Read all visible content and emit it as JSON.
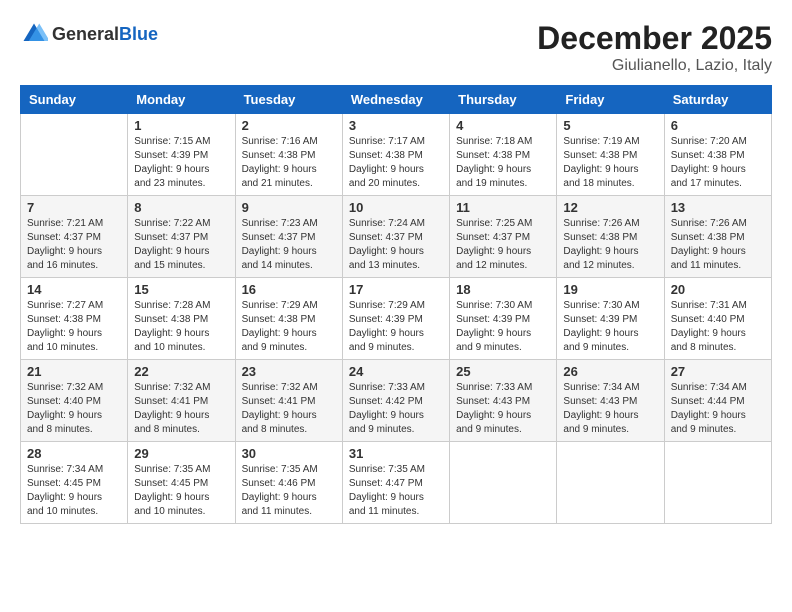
{
  "logo": {
    "general": "General",
    "blue": "Blue"
  },
  "title": "December 2025",
  "location": "Giulianello, Lazio, Italy",
  "days_of_week": [
    "Sunday",
    "Monday",
    "Tuesday",
    "Wednesday",
    "Thursday",
    "Friday",
    "Saturday"
  ],
  "weeks": [
    [
      {
        "day": "",
        "sunrise": "",
        "sunset": "",
        "daylight": ""
      },
      {
        "day": "1",
        "sunrise": "Sunrise: 7:15 AM",
        "sunset": "Sunset: 4:39 PM",
        "daylight": "Daylight: 9 hours and 23 minutes."
      },
      {
        "day": "2",
        "sunrise": "Sunrise: 7:16 AM",
        "sunset": "Sunset: 4:38 PM",
        "daylight": "Daylight: 9 hours and 21 minutes."
      },
      {
        "day": "3",
        "sunrise": "Sunrise: 7:17 AM",
        "sunset": "Sunset: 4:38 PM",
        "daylight": "Daylight: 9 hours and 20 minutes."
      },
      {
        "day": "4",
        "sunrise": "Sunrise: 7:18 AM",
        "sunset": "Sunset: 4:38 PM",
        "daylight": "Daylight: 9 hours and 19 minutes."
      },
      {
        "day": "5",
        "sunrise": "Sunrise: 7:19 AM",
        "sunset": "Sunset: 4:38 PM",
        "daylight": "Daylight: 9 hours and 18 minutes."
      },
      {
        "day": "6",
        "sunrise": "Sunrise: 7:20 AM",
        "sunset": "Sunset: 4:38 PM",
        "daylight": "Daylight: 9 hours and 17 minutes."
      }
    ],
    [
      {
        "day": "7",
        "sunrise": "Sunrise: 7:21 AM",
        "sunset": "Sunset: 4:37 PM",
        "daylight": "Daylight: 9 hours and 16 minutes."
      },
      {
        "day": "8",
        "sunrise": "Sunrise: 7:22 AM",
        "sunset": "Sunset: 4:37 PM",
        "daylight": "Daylight: 9 hours and 15 minutes."
      },
      {
        "day": "9",
        "sunrise": "Sunrise: 7:23 AM",
        "sunset": "Sunset: 4:37 PM",
        "daylight": "Daylight: 9 hours and 14 minutes."
      },
      {
        "day": "10",
        "sunrise": "Sunrise: 7:24 AM",
        "sunset": "Sunset: 4:37 PM",
        "daylight": "Daylight: 9 hours and 13 minutes."
      },
      {
        "day": "11",
        "sunrise": "Sunrise: 7:25 AM",
        "sunset": "Sunset: 4:37 PM",
        "daylight": "Daylight: 9 hours and 12 minutes."
      },
      {
        "day": "12",
        "sunrise": "Sunrise: 7:26 AM",
        "sunset": "Sunset: 4:38 PM",
        "daylight": "Daylight: 9 hours and 12 minutes."
      },
      {
        "day": "13",
        "sunrise": "Sunrise: 7:26 AM",
        "sunset": "Sunset: 4:38 PM",
        "daylight": "Daylight: 9 hours and 11 minutes."
      }
    ],
    [
      {
        "day": "14",
        "sunrise": "Sunrise: 7:27 AM",
        "sunset": "Sunset: 4:38 PM",
        "daylight": "Daylight: 9 hours and 10 minutes."
      },
      {
        "day": "15",
        "sunrise": "Sunrise: 7:28 AM",
        "sunset": "Sunset: 4:38 PM",
        "daylight": "Daylight: 9 hours and 10 minutes."
      },
      {
        "day": "16",
        "sunrise": "Sunrise: 7:29 AM",
        "sunset": "Sunset: 4:38 PM",
        "daylight": "Daylight: 9 hours and 9 minutes."
      },
      {
        "day": "17",
        "sunrise": "Sunrise: 7:29 AM",
        "sunset": "Sunset: 4:39 PM",
        "daylight": "Daylight: 9 hours and 9 minutes."
      },
      {
        "day": "18",
        "sunrise": "Sunrise: 7:30 AM",
        "sunset": "Sunset: 4:39 PM",
        "daylight": "Daylight: 9 hours and 9 minutes."
      },
      {
        "day": "19",
        "sunrise": "Sunrise: 7:30 AM",
        "sunset": "Sunset: 4:39 PM",
        "daylight": "Daylight: 9 hours and 9 minutes."
      },
      {
        "day": "20",
        "sunrise": "Sunrise: 7:31 AM",
        "sunset": "Sunset: 4:40 PM",
        "daylight": "Daylight: 9 hours and 8 minutes."
      }
    ],
    [
      {
        "day": "21",
        "sunrise": "Sunrise: 7:32 AM",
        "sunset": "Sunset: 4:40 PM",
        "daylight": "Daylight: 9 hours and 8 minutes."
      },
      {
        "day": "22",
        "sunrise": "Sunrise: 7:32 AM",
        "sunset": "Sunset: 4:41 PM",
        "daylight": "Daylight: 9 hours and 8 minutes."
      },
      {
        "day": "23",
        "sunrise": "Sunrise: 7:32 AM",
        "sunset": "Sunset: 4:41 PM",
        "daylight": "Daylight: 9 hours and 8 minutes."
      },
      {
        "day": "24",
        "sunrise": "Sunrise: 7:33 AM",
        "sunset": "Sunset: 4:42 PM",
        "daylight": "Daylight: 9 hours and 9 minutes."
      },
      {
        "day": "25",
        "sunrise": "Sunrise: 7:33 AM",
        "sunset": "Sunset: 4:43 PM",
        "daylight": "Daylight: 9 hours and 9 minutes."
      },
      {
        "day": "26",
        "sunrise": "Sunrise: 7:34 AM",
        "sunset": "Sunset: 4:43 PM",
        "daylight": "Daylight: 9 hours and 9 minutes."
      },
      {
        "day": "27",
        "sunrise": "Sunrise: 7:34 AM",
        "sunset": "Sunset: 4:44 PM",
        "daylight": "Daylight: 9 hours and 9 minutes."
      }
    ],
    [
      {
        "day": "28",
        "sunrise": "Sunrise: 7:34 AM",
        "sunset": "Sunset: 4:45 PM",
        "daylight": "Daylight: 9 hours and 10 minutes."
      },
      {
        "day": "29",
        "sunrise": "Sunrise: 7:35 AM",
        "sunset": "Sunset: 4:45 PM",
        "daylight": "Daylight: 9 hours and 10 minutes."
      },
      {
        "day": "30",
        "sunrise": "Sunrise: 7:35 AM",
        "sunset": "Sunset: 4:46 PM",
        "daylight": "Daylight: 9 hours and 11 minutes."
      },
      {
        "day": "31",
        "sunrise": "Sunrise: 7:35 AM",
        "sunset": "Sunset: 4:47 PM",
        "daylight": "Daylight: 9 hours and 11 minutes."
      },
      {
        "day": "",
        "sunrise": "",
        "sunset": "",
        "daylight": ""
      },
      {
        "day": "",
        "sunrise": "",
        "sunset": "",
        "daylight": ""
      },
      {
        "day": "",
        "sunrise": "",
        "sunset": "",
        "daylight": ""
      }
    ]
  ]
}
